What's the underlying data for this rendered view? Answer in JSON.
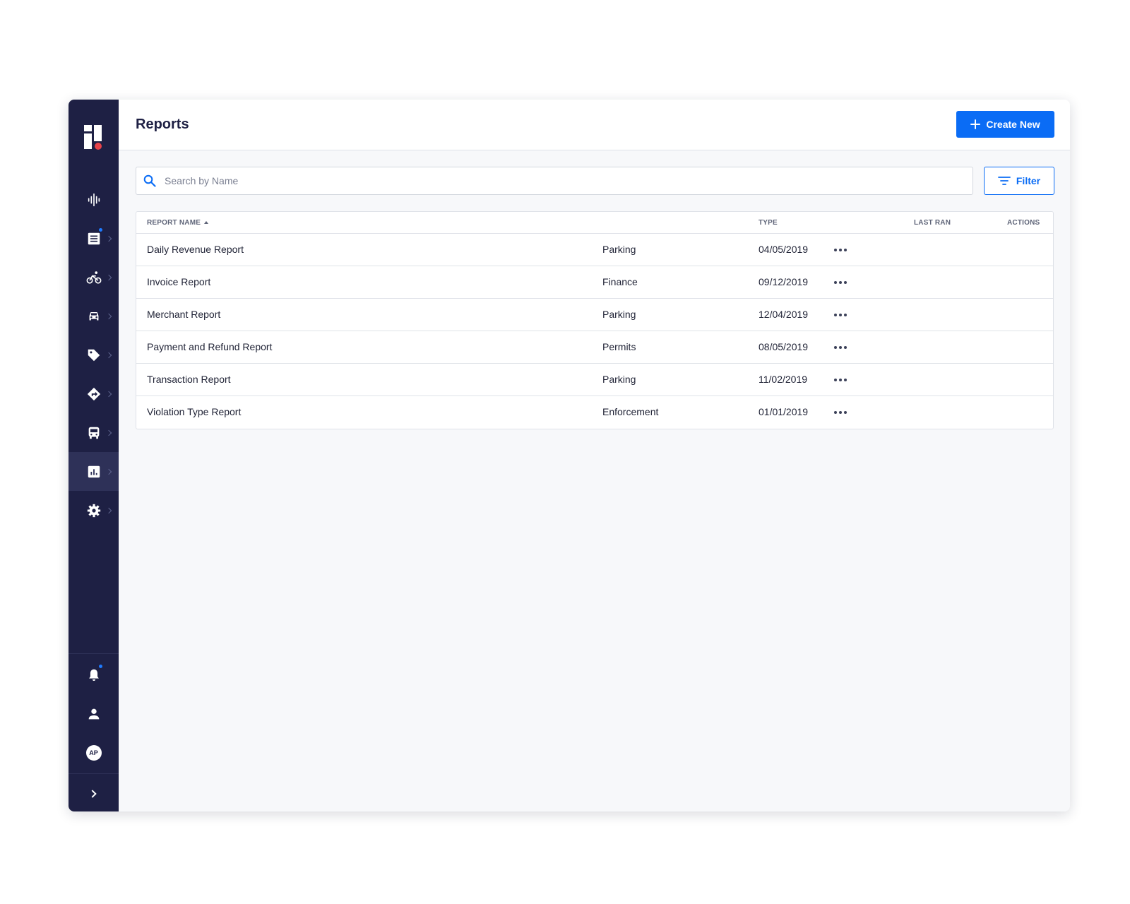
{
  "header": {
    "title": "Reports",
    "create_label": "Create New"
  },
  "search": {
    "placeholder": "Search by Name",
    "value": ""
  },
  "filter": {
    "label": "Filter"
  },
  "table": {
    "columns": [
      "REPORT NAME",
      "TYPE",
      "LAST RAN",
      "ACTIONS"
    ],
    "sort": {
      "column": "REPORT NAME",
      "direction": "ascending"
    },
    "rows": [
      {
        "name": "Daily Revenue Report",
        "type": "Parking",
        "last_ran": "04/05/2019"
      },
      {
        "name": "Invoice Report",
        "type": "Finance",
        "last_ran": "09/12/2019"
      },
      {
        "name": "Merchant Report",
        "type": "Parking",
        "last_ran": "12/04/2019"
      },
      {
        "name": "Payment and Refund Report",
        "type": "Permits",
        "last_ran": "08/05/2019"
      },
      {
        "name": "Transaction Report",
        "type": "Parking",
        "last_ran": "11/02/2019"
      },
      {
        "name": "Violation Type Report",
        "type": "Enforcement",
        "last_ran": "01/01/2019"
      }
    ]
  },
  "sidebar": {
    "items": [
      {
        "icon": "activity-icon",
        "has_chevron": false,
        "notification": false,
        "active": false
      },
      {
        "icon": "list-icon",
        "has_chevron": true,
        "notification": true,
        "active": false
      },
      {
        "icon": "bicycle-icon",
        "has_chevron": true,
        "notification": false,
        "active": false
      },
      {
        "icon": "car-icon",
        "has_chevron": true,
        "notification": false,
        "active": false
      },
      {
        "icon": "tag-icon",
        "has_chevron": true,
        "notification": false,
        "active": false
      },
      {
        "icon": "directions-icon",
        "has_chevron": true,
        "notification": false,
        "active": false
      },
      {
        "icon": "bus-icon",
        "has_chevron": true,
        "notification": false,
        "active": false
      },
      {
        "icon": "bar-chart-icon",
        "has_chevron": true,
        "notification": false,
        "active": true
      },
      {
        "icon": "gear-icon",
        "has_chevron": true,
        "notification": false,
        "active": false
      }
    ],
    "bottom": {
      "notifications_dot": true,
      "avatar_initials": "AP"
    }
  },
  "colors": {
    "sidebar_bg": "#1e2044",
    "sidebar_active": "#2e3158",
    "accent": "#0a6cf5",
    "notification": "#1f7bff",
    "logo_dot": "#e8434a"
  }
}
